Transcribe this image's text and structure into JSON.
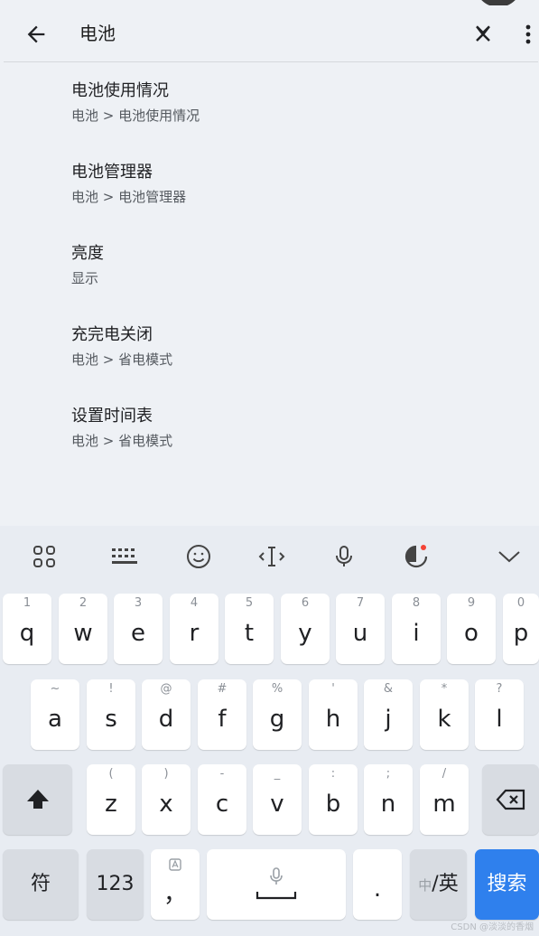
{
  "search": {
    "query": "电池"
  },
  "results": [
    {
      "title": "电池使用情况",
      "path": "电池 > 电池使用情况"
    },
    {
      "title": "电池管理器",
      "path": "电池 > 电池管理器"
    },
    {
      "title": "亮度",
      "path": "显示"
    },
    {
      "title": "充完电关闭",
      "path": "电池 > 省电模式"
    },
    {
      "title": "设置时间表",
      "path": "电池 > 省电模式"
    }
  ],
  "keyboard": {
    "toolbar_icons": [
      "apps-grid-icon",
      "keyboard-layout-icon",
      "emoji-icon",
      "cursor-move-icon",
      "microphone-icon",
      "theme-icon",
      "collapse-chevron-icon"
    ],
    "row1": [
      {
        "k": "q",
        "h": "1"
      },
      {
        "k": "w",
        "h": "2"
      },
      {
        "k": "e",
        "h": "3"
      },
      {
        "k": "r",
        "h": "4"
      },
      {
        "k": "t",
        "h": "5"
      },
      {
        "k": "y",
        "h": "6"
      },
      {
        "k": "u",
        "h": "7"
      },
      {
        "k": "i",
        "h": "8"
      },
      {
        "k": "o",
        "h": "9"
      },
      {
        "k": "p",
        "h": "0"
      }
    ],
    "row2": [
      {
        "k": "a",
        "h": "~"
      },
      {
        "k": "s",
        "h": "!"
      },
      {
        "k": "d",
        "h": "@"
      },
      {
        "k": "f",
        "h": "#"
      },
      {
        "k": "g",
        "h": "%"
      },
      {
        "k": "h",
        "h": "'"
      },
      {
        "k": "j",
        "h": "&"
      },
      {
        "k": "k",
        "h": "*"
      },
      {
        "k": "l",
        "h": "?"
      }
    ],
    "row3": [
      {
        "k": "z",
        "h": "("
      },
      {
        "k": "x",
        "h": ")"
      },
      {
        "k": "c",
        "h": "-"
      },
      {
        "k": "v",
        "h": "_"
      },
      {
        "k": "b",
        "h": ":"
      },
      {
        "k": "n",
        "h": ";"
      },
      {
        "k": "m",
        "h": "/"
      }
    ],
    "symbols_label": "符",
    "numbers_label": "123",
    "comma_label": "，",
    "period_label": ".",
    "lang_small": "中",
    "lang_big": "/英",
    "search_label": "搜索",
    "accent_color": "#2f80ed"
  },
  "watermark": "CSDN @淡淡的香烟"
}
